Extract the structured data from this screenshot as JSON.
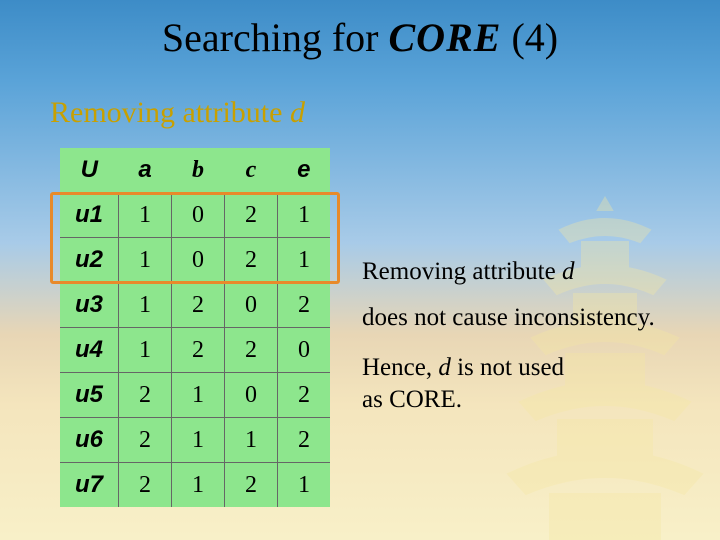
{
  "title": {
    "pre": "Searching for ",
    "core": "CORE",
    "post": " (4)"
  },
  "subtitle": {
    "text": "Removing attribute ",
    "var": "d"
  },
  "table": {
    "headers": [
      "U",
      "a",
      "b",
      "c",
      "e"
    ],
    "rowlabels": [
      "u1",
      "u2",
      "u3",
      "u4",
      "u5",
      "u6",
      "u7"
    ],
    "rows": [
      [
        1,
        0,
        2,
        1
      ],
      [
        1,
        0,
        2,
        1
      ],
      [
        1,
        2,
        0,
        2
      ],
      [
        1,
        2,
        2,
        0
      ],
      [
        2,
        1,
        0,
        2
      ],
      [
        2,
        1,
        1,
        2
      ],
      [
        2,
        1,
        2,
        1
      ]
    ]
  },
  "body": {
    "line1_pre": "Removing attribute ",
    "line1_var": "d",
    "line2": "does not cause inconsistency.",
    "line3_pre": "Hence, ",
    "line3_var": "d",
    "line3_post": " is not used",
    "line4": "as CORE."
  },
  "chart_data": {
    "type": "table",
    "title": "Removing attribute d",
    "columns": [
      "U",
      "a",
      "b",
      "c",
      "e"
    ],
    "rows": [
      [
        "u1",
        1,
        0,
        2,
        1
      ],
      [
        "u2",
        1,
        0,
        2,
        1
      ],
      [
        "u3",
        1,
        2,
        0,
        2
      ],
      [
        "u4",
        1,
        2,
        2,
        0
      ],
      [
        "u5",
        2,
        1,
        0,
        2
      ],
      [
        "u6",
        2,
        1,
        1,
        2
      ],
      [
        "u7",
        2,
        1,
        2,
        1
      ]
    ],
    "highlighted_rows": [
      "u1",
      "u2"
    ]
  }
}
